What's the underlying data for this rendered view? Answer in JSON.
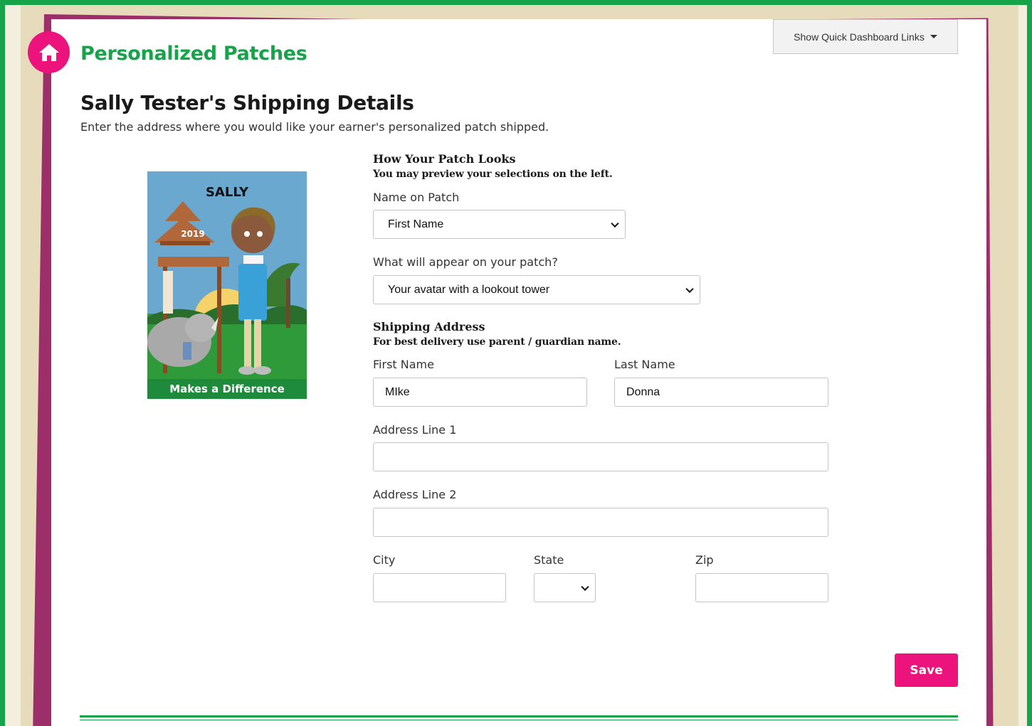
{
  "app": {
    "title": "Personalized Patches"
  },
  "header": {
    "dashboard_links_label": "Show Quick Dashboard Links"
  },
  "page": {
    "title": "Sally Tester's Shipping Details",
    "subtitle": "Enter the address where you would like your earner's personalized patch shipped."
  },
  "patch_preview": {
    "name": "SALLY",
    "year": "2019",
    "motto": "Makes a Difference",
    "colors": {
      "sky": "#6aa8d0",
      "grass": "#2e9a3a",
      "band": "#1e8a3c",
      "tower": "#b0683a"
    }
  },
  "patch_looks": {
    "heading": "How Your Patch Looks",
    "subheading": "You may preview your selections on the left.",
    "name_label": "Name on Patch",
    "name_value": "First Name",
    "appear_label": "What will appear on your patch?",
    "appear_value": "Your avatar with a lookout tower"
  },
  "shipping": {
    "heading": "Shipping Address",
    "subheading": "For best delivery use parent / guardian name.",
    "first_name_label": "First Name",
    "first_name_value": "MIke",
    "last_name_label": "Last Name",
    "last_name_value": "Donna",
    "address1_label": "Address Line 1",
    "address1_value": "",
    "address2_label": "Address Line 2",
    "address2_value": "",
    "city_label": "City",
    "city_value": "",
    "state_label": "State",
    "state_value": "",
    "zip_label": "Zip",
    "zip_value": ""
  },
  "actions": {
    "save_label": "Save"
  },
  "theme": {
    "accent_green": "#16a34a",
    "accent_pink": "#ec137d",
    "paper_purple": "#9c2f6a"
  },
  "icons": {
    "home": "home-icon",
    "caret": "caret-down-icon",
    "chevron": "chevron-down-icon"
  }
}
